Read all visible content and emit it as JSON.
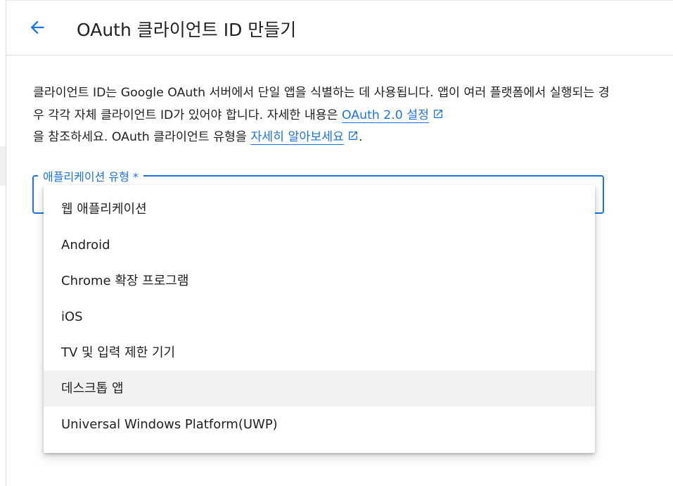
{
  "header": {
    "title": "OAuth 클라이언트 ID 만들기"
  },
  "description": {
    "part1": "클라이언트 ID는 Google OAuth 서버에서 단일 앱을 식별하는 데 사용됩니다. 앱이 여러 플랫폼에서 실행되는 경우 각각 자체 클라이언트 ID가 있어야 합니다. 자세한 내용은 ",
    "link1": "OAuth 2.0 설정",
    "part2": "을 참조하세요. OAuth 클라이언트 유형을 ",
    "link2": "자세히 알아보세요",
    "part3": "."
  },
  "app_type_field": {
    "label": "애플리케이션 유형 *"
  },
  "menu": {
    "items": [
      {
        "label": "웹 애플리케이션"
      },
      {
        "label": "Android"
      },
      {
        "label": "Chrome 확장 프로그램"
      },
      {
        "label": "iOS"
      },
      {
        "label": "TV 및 입력 제한 기기"
      },
      {
        "label": "데스크톱 앱"
      },
      {
        "label": "Universal Windows Platform(UWP)"
      }
    ]
  },
  "colors": {
    "accent": "#1a73e8",
    "text": "#202124",
    "hover_bg": "#f1f1f1"
  },
  "icons": {
    "back": "arrow-back-icon",
    "external_link": "open-in-new-icon"
  }
}
